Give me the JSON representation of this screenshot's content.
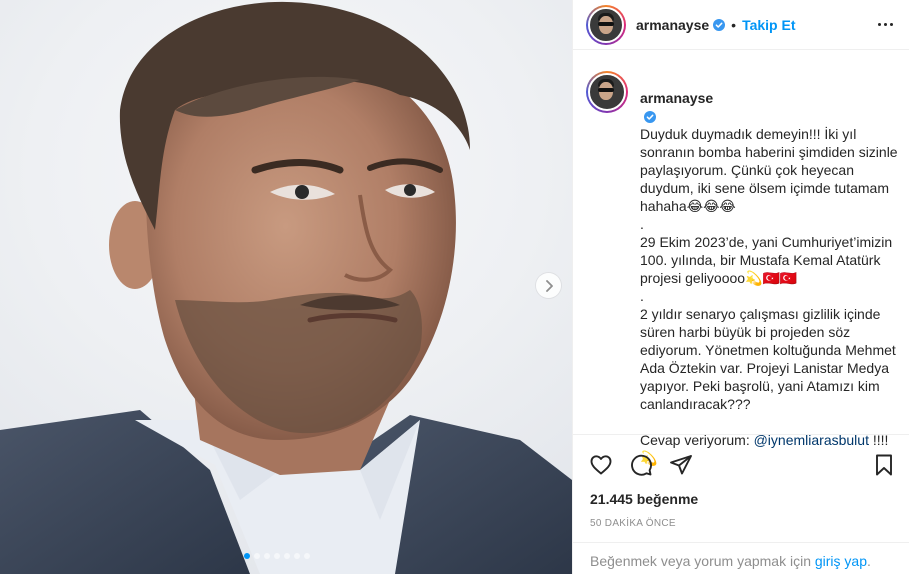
{
  "post": {
    "username": "armanayse",
    "follow_label": "Takip Et",
    "separator": "•",
    "carousel": {
      "dot_count": 7,
      "active_index": 0
    },
    "caption": {
      "username": "armanayse",
      "paragraphs": [
        "Duyduk duymadık demeyin!!! İki yıl sonranın bomba haberini şimdiden sizinle paylaşıyorum. Çünkü çok heyecan duydum, iki sene ölsem içimde tutamam hahaha😂😂😂",
        ".",
        "29 Ekim 2023’de, yani Cumhuriyet’imizin 100. yılında, bir Mustafa Kemal Atatürk projesi geliyoooo💫🇹🇷🇹🇷",
        ".",
        "2 yıldır senaryo çalışması gizlilik içinde süren harbi büyük bi projeden söz ediyorum. Yönetmen koltuğunda Mehmet Ada Öztekin var. Projeyi Lanistar Medya yapıyor. Peki başrolü, yani Atamızı kim canlandıracak???"
      ],
      "last_line_prefix": "Cevap veriyorum: ",
      "mention": "@iynemliarasbulut",
      "last_line_suffix": " !!!!💫"
    },
    "likes_text": "21.445 beğenme",
    "time_text": "50 DAKİKA ÖNCE",
    "login_prompt_prefix": "Beğenmek veya yorum yapmak için ",
    "login_link": "giriş yap",
    "login_prompt_suffix": "."
  },
  "colors": {
    "accent_blue": "#0095f6",
    "text": "#262626",
    "muted": "#8e8e8e",
    "border": "#efefef"
  },
  "icons": [
    "verified-badge-icon",
    "more-options-icon",
    "next-arrow-icon",
    "heart-icon",
    "comment-icon",
    "share-icon",
    "bookmark-icon"
  ]
}
